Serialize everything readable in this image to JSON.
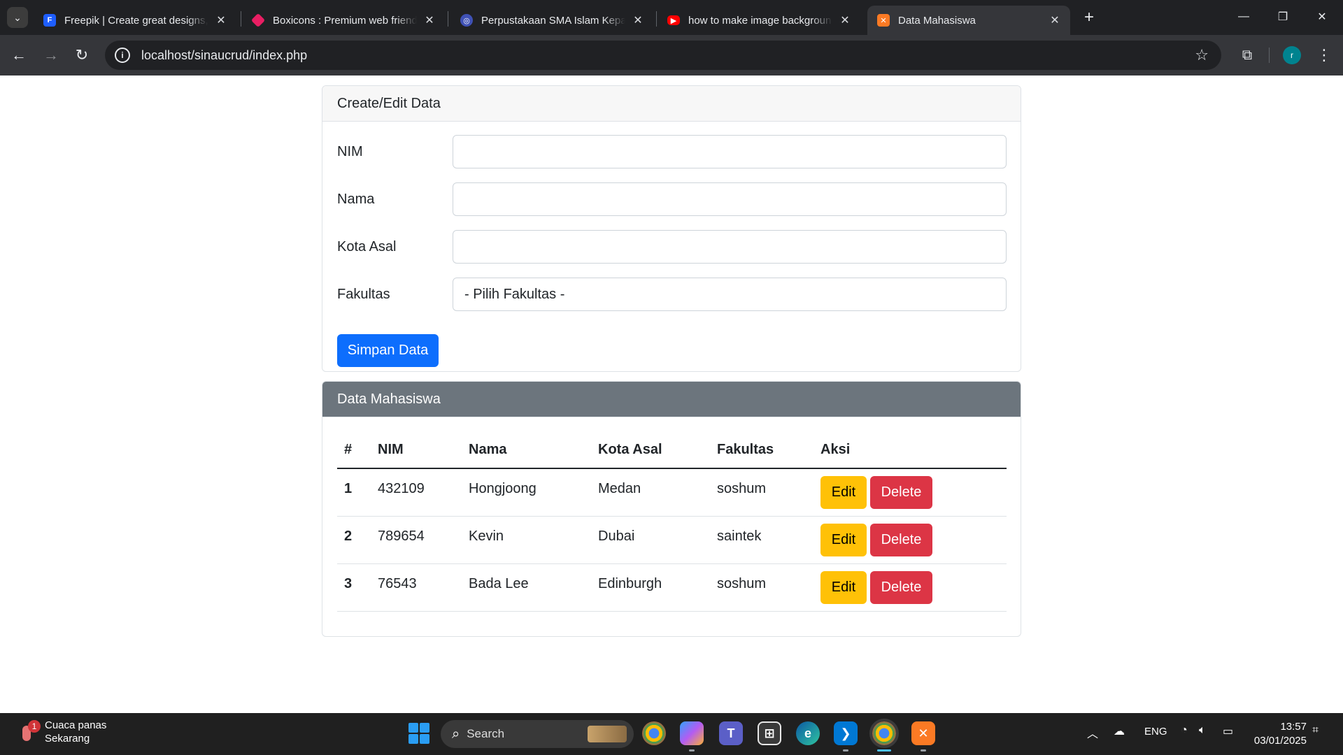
{
  "browser": {
    "tabs": [
      {
        "title": "Freepik | Create great designs, f",
        "icon": "freepik-icon",
        "color": "#1e5eff"
      },
      {
        "title": "Boxicons : Premium web friendl",
        "icon": "boxicons-icon",
        "color": "#e91e63"
      },
      {
        "title": "Perpustakaan SMA Islam Kepan",
        "icon": "library-icon",
        "color": "#3f51b5"
      },
      {
        "title": "how to make image backgroun",
        "icon": "youtube-icon",
        "color": "#ff0000"
      },
      {
        "title": "Data Mahasiswa",
        "icon": "xampp-icon",
        "color": "#fb7a24"
      }
    ],
    "url": "localhost/sinaucrud/index.php",
    "profile_initial": "r"
  },
  "form": {
    "header": "Create/Edit Data",
    "fields": [
      {
        "label": "NIM",
        "value": ""
      },
      {
        "label": "Nama",
        "value": ""
      },
      {
        "label": "Kota Asal",
        "value": ""
      },
      {
        "label": "Fakultas",
        "value": "- Pilih Fakultas -"
      }
    ],
    "submit_label": "Simpan Data"
  },
  "table": {
    "header": "Data Mahasiswa",
    "columns": [
      "#",
      "NIM",
      "Nama",
      "Kota Asal",
      "Fakultas",
      "Aksi"
    ],
    "rows": [
      {
        "no": "1",
        "nim": "432109",
        "nama": "Hongjoong",
        "kota": "Medan",
        "fakultas": "soshum"
      },
      {
        "no": "2",
        "nim": "789654",
        "nama": "Kevin",
        "kota": "Dubai",
        "fakultas": "saintek"
      },
      {
        "no": "3",
        "nim": "76543",
        "nama": "Bada Lee",
        "kota": "Edinburgh",
        "fakultas": "soshum"
      }
    ],
    "edit_label": "Edit",
    "delete_label": "Delete"
  },
  "taskbar": {
    "weather_title": "Cuaca panas",
    "weather_sub": "Sekarang",
    "weather_badge": "1",
    "search_label": "Search",
    "lang": "ENG",
    "time": "13:57",
    "date": "03/01/2025"
  }
}
